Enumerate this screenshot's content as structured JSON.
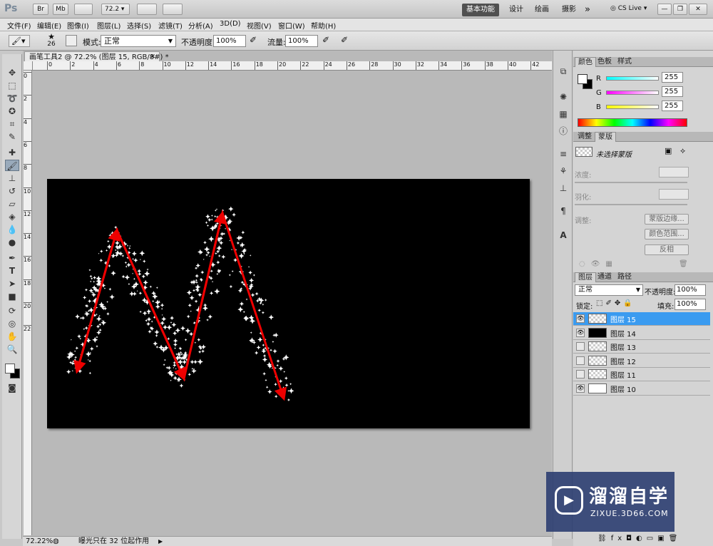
{
  "appbar": {
    "logo": "Ps",
    "bridge": "Br",
    "minibridge": "Mb",
    "zoom": "72.2",
    "workspaces": [
      "基本功能",
      "设计",
      "绘画",
      "摄影"
    ],
    "more": "»",
    "cslive": "CS Live",
    "win_buttons": [
      "—",
      "❐",
      "✕"
    ]
  },
  "menu": [
    "文件(F)",
    "编辑(E)",
    "图像(I)",
    "图层(L)",
    "选择(S)",
    "滤镜(T)",
    "分析(A)",
    "3D(D)",
    "视图(V)",
    "窗口(W)",
    "帮助(H)"
  ],
  "options": {
    "brush_size": "26",
    "mode_label": "模式:",
    "mode_value": "正常",
    "opacity_label": "不透明度:",
    "opacity_value": "100%",
    "flow_label": "流量:",
    "flow_value": "100%"
  },
  "document": {
    "tab_title": "画笔工具2 @ 72.2% (图层 15, RGB/8#) *",
    "ruler_h": [
      "0",
      "2",
      "4",
      "6",
      "8",
      "10",
      "12",
      "14",
      "16",
      "18",
      "20",
      "22",
      "24",
      "26",
      "28",
      "30",
      "32",
      "34",
      "36",
      "38",
      "40",
      "42"
    ],
    "ruler_v": [
      "0",
      "2",
      "4",
      "6",
      "8",
      "10",
      "12",
      "14",
      "16",
      "18",
      "20",
      "22"
    ]
  },
  "status": {
    "zoom": "72.22%",
    "info": "曝光只在 32 位起作用"
  },
  "color_panel": {
    "tabs": [
      "颜色",
      "色板",
      "样式"
    ],
    "channels": [
      {
        "name": "R",
        "value": "255",
        "color": "#ff0000"
      },
      {
        "name": "G",
        "value": "255",
        "color": "#00ff00"
      },
      {
        "name": "B",
        "value": "255",
        "color": "#0000ff"
      }
    ]
  },
  "mask_panel": {
    "tabs": [
      "调整",
      "蒙版"
    ],
    "status": "未选择蒙版",
    "density_label": "浓度:",
    "feather_label": "羽化:",
    "refine_label": "调整:",
    "buttons": [
      "蒙版边缘...",
      "颜色范围...",
      "反相"
    ]
  },
  "layers_panel": {
    "tabs": [
      "图层",
      "通道",
      "路径"
    ],
    "blend_mode": "正常",
    "opacity_label": "不透明度:",
    "opacity_value": "100%",
    "lock_label": "锁定:",
    "fill_label": "填充:",
    "fill_value": "100%",
    "layers": [
      {
        "name": "图层 15",
        "visible": true,
        "selected": true,
        "thumb": "transparent"
      },
      {
        "name": "图层 14",
        "visible": true,
        "selected": false,
        "thumb": "black"
      },
      {
        "name": "图层 13",
        "visible": false,
        "selected": false,
        "thumb": "transparent"
      },
      {
        "name": "图层 12",
        "visible": false,
        "selected": false,
        "thumb": "transparent"
      },
      {
        "name": "图层 11",
        "visible": false,
        "selected": false,
        "thumb": "transparent"
      },
      {
        "name": "图层 10",
        "visible": true,
        "selected": false,
        "thumb": "white"
      }
    ]
  },
  "watermark": {
    "name": "溜溜自学",
    "url": "ZIXUE.3D66.COM"
  }
}
